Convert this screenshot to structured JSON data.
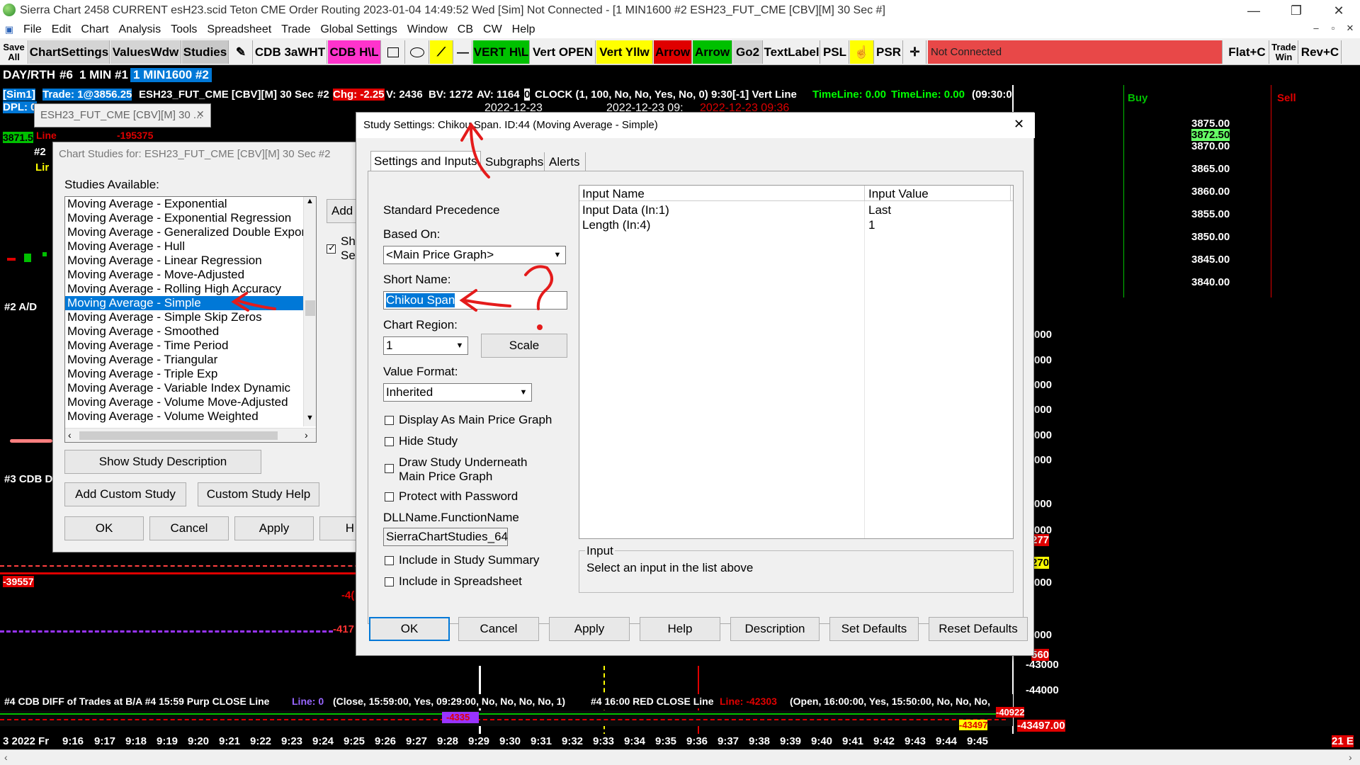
{
  "titlebar": {
    "title": "Sierra Chart 2458 CURRENT esH23.scid  Teton CME Order Routing 2023-01-04  14:49:52 Wed [Sim]  Not Connected - [1 MIN1600 #2 ESH23_FUT_CME [CBV][M]  30 Sec   #]",
    "minimize": "—",
    "restore": "❐",
    "close": "✕"
  },
  "menubar": {
    "items": [
      "File",
      "Edit",
      "Chart",
      "Analysis",
      "Tools",
      "Spreadsheet",
      "Trade",
      "Global Settings",
      "Window",
      "CB",
      "CW",
      "Help"
    ],
    "mdi": [
      "–",
      "▫",
      "✕"
    ]
  },
  "toolbar": {
    "save_all": [
      "Save",
      "All"
    ],
    "buttons": [
      "ChartSettings",
      "ValuesWdw",
      "Studies",
      "CDB 3aWHT",
      "CDB H\\L",
      "VERT H\\L",
      "Vert OPEN",
      "Vert Yllw",
      "Arrow",
      "Arrow",
      "Go2",
      "TextLabel",
      "PSL",
      "PSR"
    ],
    "status": "Not Connected",
    "flat": "Flat+C",
    "trade_win": [
      "Trade",
      "Win"
    ],
    "rev": "Rev+C"
  },
  "row2": {
    "dayrth": "DAY/RTH",
    "n6": "#6",
    "min1": "1 MIN #1",
    "min1600": "1 MIN1600 #2"
  },
  "chart": {
    "header": {
      "sim": "[Sim1]",
      "trade": "Trade: 1@3856.25",
      "symbol": "ESH23_FUT_CME [CBV][M]  30 Sec",
      "n2": "#2",
      "chg": "Chg: -2.25",
      "v": "V: 2436",
      "bv": "BV: 1272",
      "av": "AV: 1164",
      "zero": "0",
      "clock": "CLOCK   (1, 100, No, No, Yes, No, 0)  9:30[-1] Vert Line",
      "timeline1": "TimeLine: 0.00",
      "timeline2": "TimeLine: 0.00",
      "tail": "(09:30:0"
    },
    "dpl": "DPL: 0",
    "line_label": "Line",
    "line_value": "-195375",
    "price_marker": "3871.5",
    "n2_label": "#2",
    "lin_label": "Lir",
    "ad_label": "#2 A/D",
    "cdb_label": "#3 CDB D",
    "neg39557": "-39557",
    "neg4": "-4(",
    "neg417": "-417",
    "date1": "2022-12-23",
    "date2": "2022-12-23  09:",
    "date3": "2022-12-23  09:36",
    "buy": "Buy",
    "sell": "Sell",
    "prices": [
      "3875.00",
      "3872.50",
      "3870.00",
      "3865.00",
      "3860.00",
      "3855.00",
      "3850.00",
      "3845.00",
      "3840.00"
    ],
    "right_vals": [
      "000",
      "000",
      "000",
      "000",
      "000",
      "000",
      "000",
      "000",
      "277",
      "270",
      "000",
      "000",
      "560",
      "-43000",
      "-44000"
    ],
    "footer_study": "#4 CDB DIFF of Trades at B/A  #4 15:59 Purp CLOSE Line",
    "footer_line0": "Line: 0",
    "footer_close": "(Close, 15:59:00, Yes, 09:29:00, No, No, No, No, 1)",
    "footer_red": "#4 16:00 RED CLOSE Line",
    "footer_line42303": "Line: -42303",
    "footer_open": "(Open, 16:00:00, Yes, 15:50:00, No, No, No,",
    "val_40922": "-40922",
    "val_43497a": "-43497",
    "val_43497b": "-43497.00",
    "val_4335": "-4335",
    "time_axis": [
      "3 2022 Fr",
      "9:16",
      "9:17",
      "9:18",
      "9:19",
      "9:20",
      "9:21",
      "9:22",
      "9:23",
      "9:24",
      "9:25",
      "9:26",
      "9:27",
      "9:28",
      "9:29",
      "9:30",
      "9:31",
      "9:32",
      "9:33",
      "9:34",
      "9:35",
      "9:36",
      "9:37",
      "9:38",
      "9:39",
      "9:40",
      "9:41",
      "9:42",
      "9:43",
      "9:44",
      "9:45"
    ],
    "time_right": "21 E"
  },
  "small_window": {
    "title": "ESH23_FUT_CME [CBV][M]  30 ...",
    "close": "✕"
  },
  "studies_dialog": {
    "title": "Chart Studies for: ESH23_FUT_CME [CBV][M]  30 Sec   #2",
    "available_label": "Studies Available:",
    "items": [
      "Moving Average - Exponential",
      "Moving Average - Exponential Regression",
      "Moving Average - Generalized Double Expon",
      "Moving Average - Hull",
      "Moving Average - Linear Regression",
      "Moving Average - Move-Adjusted",
      "Moving Average - Rolling High Accuracy",
      "Moving Average - Simple",
      "Moving Average - Simple Skip Zeros",
      "Moving Average - Smoothed",
      "Moving Average - Time Period",
      "Moving Average - Triangular",
      "Moving Average - Triple Exp",
      "Moving Average - Variable Index Dynamic",
      "Moving Average - Volume Move-Adjusted",
      "Moving Average - Volume Weighted"
    ],
    "selected_index": 7,
    "add": "Add",
    "sho": "Sh",
    "se": "Se",
    "show_desc": "Show Study Description",
    "add_custom": "Add Custom Study",
    "custom_help": "Custom Study Help",
    "ok": "OK",
    "cancel": "Cancel",
    "apply": "Apply",
    "h": "H"
  },
  "settings_dialog": {
    "title": "Study Settings: Chikou Span. ID:44 (Moving Average - Simple)",
    "close": "✕",
    "tabs": [
      "Settings and Inputs",
      "Subgraphs",
      "Alerts"
    ],
    "standard_precedence": "Standard Precedence",
    "based_on_label": "Based On:",
    "based_on_value": "<Main Price Graph>",
    "short_name_label": "Short Name:",
    "short_name_value": "Chikou Span",
    "chart_region_label": "Chart Region:",
    "chart_region_value": "1",
    "scale": "Scale",
    "value_format_label": "Value Format:",
    "value_format_value": "Inherited",
    "cb_display": "Display As Main Price Graph",
    "cb_hide": "Hide Study",
    "cb_draw1": "Draw Study Underneath",
    "cb_draw2": "Main Price Graph",
    "cb_protect": "Protect with Password",
    "dll_label": "DLLName.FunctionName",
    "dll_value": "SierraChartStudies_64",
    "cb_summary": "Include in Study Summary",
    "cb_spreadsheet": "Include in Spreadsheet",
    "table_headers": [
      "Input Name",
      "Input Value"
    ],
    "rows": [
      {
        "name": "Input Data    (In:1)",
        "value": "Last"
      },
      {
        "name": "Length    (In:4)",
        "value": "1"
      }
    ],
    "input_group": "Input",
    "input_hint": "Select an input in the list above",
    "buttons": [
      "OK",
      "Cancel",
      "Apply",
      "Help",
      "Description",
      "Set Defaults",
      "Reset Defaults"
    ]
  },
  "colors": {
    "sel": "#0078d7",
    "annot": "#e41b1b",
    "magenta": "#ff33cc",
    "green": "#00c000",
    "red": "#e00000",
    "yellow": "#ffff00"
  }
}
